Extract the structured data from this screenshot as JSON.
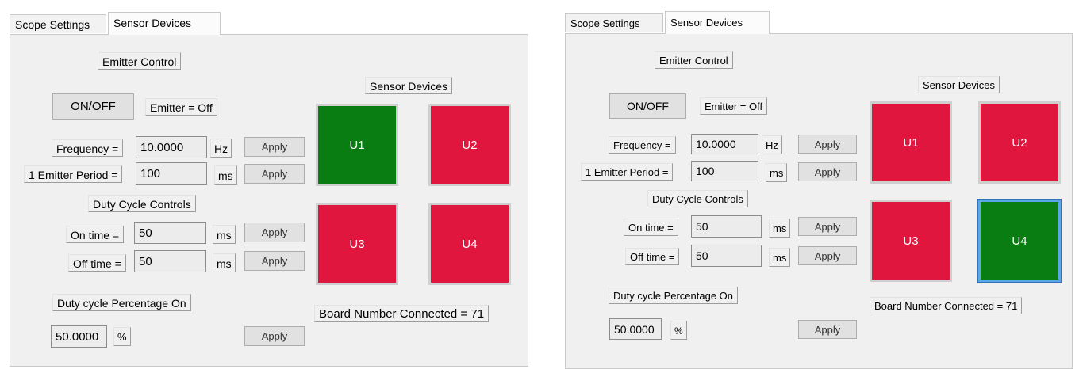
{
  "tabs": [
    "Scope Settings",
    "Sensor Devices"
  ],
  "active_tab": "Sensor Devices",
  "colors": {
    "on": "#0a7d12",
    "off": "#e0163f"
  },
  "panels": [
    {
      "emitter_control_label": "Emitter Control",
      "on_off_button": "ON/OFF",
      "emitter_status": "Emitter = Off",
      "frequency": {
        "label": "Frequency =",
        "value": "10.0000",
        "unit": "Hz",
        "apply": "Apply"
      },
      "period": {
        "label": "1 Emitter Period =",
        "value": "100",
        "unit": "ms",
        "apply": "Apply"
      },
      "duty_cycle_label": "Duty Cycle Controls",
      "on_time": {
        "label": "On time =",
        "value": "50",
        "unit": "ms",
        "apply": "Apply"
      },
      "off_time": {
        "label": "Off time =",
        "value": "50",
        "unit": "ms",
        "apply": "Apply"
      },
      "duty_pct_label": "Duty cycle Percentage On",
      "duty_pct": {
        "value": "50.0000",
        "unit": "%",
        "apply": "Apply"
      },
      "sensor_devices_label": "Sensor Devices",
      "sensors": [
        {
          "label": "U1",
          "state": "on"
        },
        {
          "label": "U2",
          "state": "off"
        },
        {
          "label": "U3",
          "state": "off"
        },
        {
          "label": "U4",
          "state": "off"
        }
      ],
      "board_number": "Board Number Connected = 71"
    },
    {
      "emitter_control_label": "Emitter Control",
      "on_off_button": "ON/OFF",
      "emitter_status": "Emitter = Off",
      "frequency": {
        "label": "Frequency =",
        "value": "10.0000",
        "unit": "Hz",
        "apply": "Apply"
      },
      "period": {
        "label": "1 Emitter Period =",
        "value": "100",
        "unit": "ms",
        "apply": "Apply"
      },
      "duty_cycle_label": "Duty Cycle Controls",
      "on_time": {
        "label": "On time =",
        "value": "50",
        "unit": "ms",
        "apply": "Apply"
      },
      "off_time": {
        "label": "Off time =",
        "value": "50",
        "unit": "ms",
        "apply": "Apply"
      },
      "duty_pct_label": "Duty cycle Percentage On",
      "duty_pct": {
        "value": "50.0000",
        "unit": "%",
        "apply": "Apply"
      },
      "sensor_devices_label": "Sensor Devices",
      "sensors": [
        {
          "label": "U1",
          "state": "off"
        },
        {
          "label": "U2",
          "state": "off"
        },
        {
          "label": "U3",
          "state": "off"
        },
        {
          "label": "U4",
          "state": "on",
          "selected": true
        }
      ],
      "board_number": "Board Number Connected = 71"
    }
  ]
}
